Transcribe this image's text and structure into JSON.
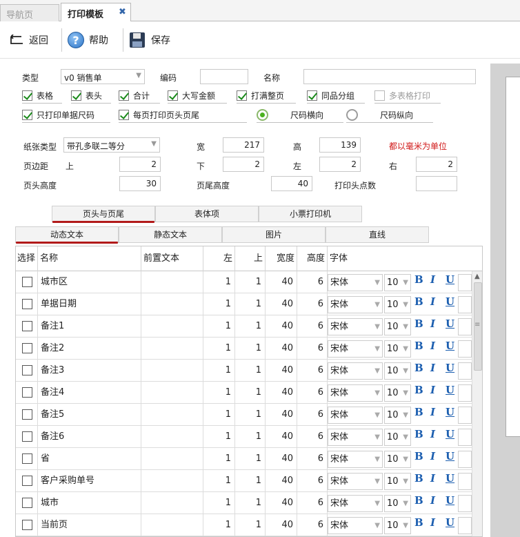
{
  "tabs": [
    {
      "label": "导航页",
      "active": false
    },
    {
      "label": "打印模板",
      "active": true,
      "close": "✖"
    }
  ],
  "toolbar": {
    "back": "返回",
    "help": "帮助",
    "save": "保存"
  },
  "form": {
    "type_label": "类型",
    "type_value": "v0 销售单",
    "code_label": "编码",
    "code_value": "",
    "name_label": "名称",
    "name_value": ""
  },
  "options": [
    {
      "label": "表格",
      "checked": true
    },
    {
      "label": "表头",
      "checked": true
    },
    {
      "label": "合计",
      "checked": true
    },
    {
      "label": "大写金额",
      "checked": true
    },
    {
      "label": "打满整页",
      "checked": true
    },
    {
      "label": "同品分组",
      "checked": true
    },
    {
      "label": "多表格打印",
      "checked": false,
      "disabled": true
    },
    {
      "label": "只打印单据尺码",
      "checked": true
    },
    {
      "label": "每页打印页头页尾",
      "checked": true
    },
    {
      "label": "尺码横向",
      "checked": true,
      "radio": true
    },
    {
      "label": "尺码纵向",
      "checked": false,
      "radio": true
    }
  ],
  "paper": {
    "type_label": "纸张类型",
    "type_value": "带孔多联二等分",
    "width_label": "宽",
    "width_value": "217",
    "height_label": "高",
    "height_value": "139",
    "unit_note": "都以毫米为单位",
    "margin_label": "页边距",
    "top_label": "上",
    "top_value": "2",
    "bottom_label": "下",
    "bottom_value": "2",
    "left_label": "左",
    "left_value": "2",
    "right_label": "右",
    "right_value": "2",
    "header_h_label": "页头高度",
    "header_h_value": "30",
    "footer_h_label": "页尾高度",
    "footer_h_value": "40",
    "dots_label": "打印头点数",
    "dots_value": ""
  },
  "main_tabs": [
    "页头与页尾",
    "表体项",
    "小票打印机"
  ],
  "sub_tabs": [
    "动态文本",
    "静态文本",
    "图片",
    "直线"
  ],
  "grid": {
    "headers": [
      "选择",
      "名称",
      "前置文本",
      "左",
      "上",
      "宽度",
      "高度",
      "字体"
    ],
    "rows": [
      {
        "name": "城市区",
        "prefix": "",
        "left": "1",
        "top": "1",
        "width": "40",
        "height": "6",
        "font": "宋体",
        "size": "10"
      },
      {
        "name": "单据日期",
        "prefix": "",
        "left": "1",
        "top": "1",
        "width": "40",
        "height": "6",
        "font": "宋体",
        "size": "10"
      },
      {
        "name": "备注1",
        "prefix": "",
        "left": "1",
        "top": "1",
        "width": "40",
        "height": "6",
        "font": "宋体",
        "size": "10"
      },
      {
        "name": "备注2",
        "prefix": "",
        "left": "1",
        "top": "1",
        "width": "40",
        "height": "6",
        "font": "宋体",
        "size": "10"
      },
      {
        "name": "备注3",
        "prefix": "",
        "left": "1",
        "top": "1",
        "width": "40",
        "height": "6",
        "font": "宋体",
        "size": "10"
      },
      {
        "name": "备注4",
        "prefix": "",
        "left": "1",
        "top": "1",
        "width": "40",
        "height": "6",
        "font": "宋体",
        "size": "10"
      },
      {
        "name": "备注5",
        "prefix": "",
        "left": "1",
        "top": "1",
        "width": "40",
        "height": "6",
        "font": "宋体",
        "size": "10"
      },
      {
        "name": "备注6",
        "prefix": "",
        "left": "1",
        "top": "1",
        "width": "40",
        "height": "6",
        "font": "宋体",
        "size": "10"
      },
      {
        "name": "省",
        "prefix": "",
        "left": "1",
        "top": "1",
        "width": "40",
        "height": "6",
        "font": "宋体",
        "size": "10"
      },
      {
        "name": "客户采购单号",
        "prefix": "",
        "left": "1",
        "top": "1",
        "width": "40",
        "height": "6",
        "font": "宋体",
        "size": "10"
      },
      {
        "name": "城市",
        "prefix": "",
        "left": "1",
        "top": "1",
        "width": "40",
        "height": "6",
        "font": "宋体",
        "size": "10"
      },
      {
        "name": "当前页",
        "prefix": "",
        "left": "1",
        "top": "1",
        "width": "40",
        "height": "6",
        "font": "宋体",
        "size": "10"
      }
    ],
    "bold": "B",
    "italic": "I",
    "underline": "U"
  }
}
